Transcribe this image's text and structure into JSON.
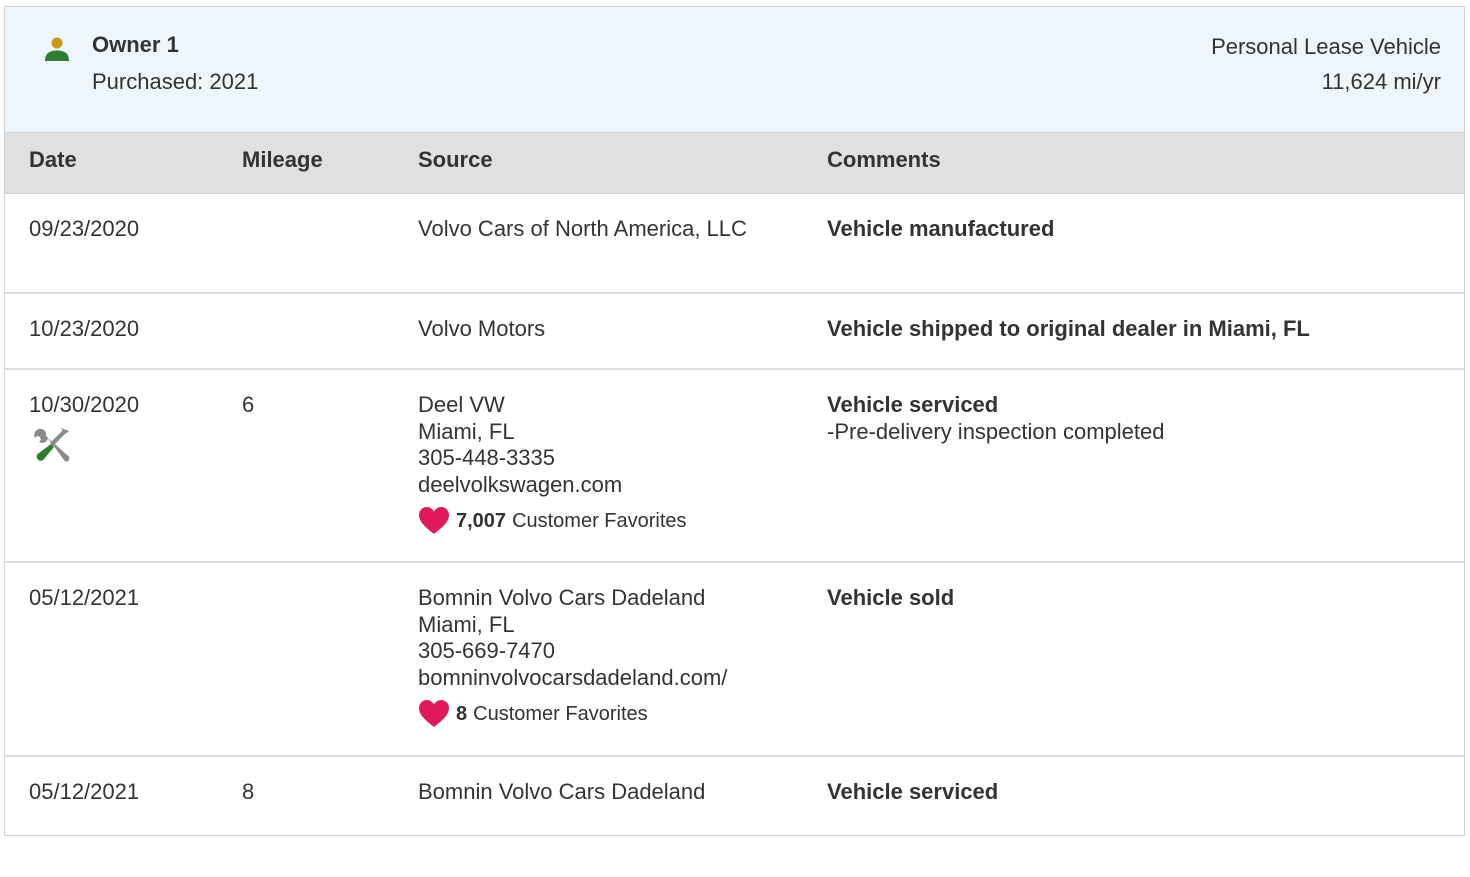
{
  "owner": {
    "title": "Owner 1",
    "purchased": "Purchased: 2021",
    "type": "Personal Lease Vehicle",
    "miles_per_year": "11,624 mi/yr"
  },
  "columns": {
    "date": "Date",
    "mileage": "Mileage",
    "source": "Source",
    "comments": "Comments"
  },
  "rows": [
    {
      "date": "09/23/2020",
      "mileage": "",
      "source": [
        "Volvo Cars of North America, LLC"
      ],
      "comment": "Vehicle manufactured"
    },
    {
      "date": "10/23/2020",
      "mileage": "",
      "source": [
        "Volvo Motors"
      ],
      "comment": "Vehicle shipped to original dealer in Miami, FL"
    },
    {
      "date": "10/30/2020",
      "mileage": "6",
      "service_icon": "wrench-screwdriver-icon",
      "source": [
        "Deel VW",
        "Miami, FL",
        "305-448-3335",
        "deelvolkswagen.com"
      ],
      "favorites_count": "7,007",
      "favorites_label": "Customer Favorites",
      "comment": "Vehicle serviced",
      "comment_detail": "-Pre-delivery inspection completed"
    },
    {
      "date": "05/12/2021",
      "mileage": "",
      "source": [
        "Bomnin Volvo Cars Dadeland",
        "Miami, FL",
        "305-669-7470",
        "bomninvolvocarsdadeland.com/"
      ],
      "favorites_count": "8",
      "favorites_label": "Customer Favorites",
      "comment": "Vehicle sold"
    },
    {
      "date": "05/12/2021",
      "mileage": "8",
      "source": [
        "Bomnin Volvo Cars Dadeland"
      ],
      "comment": "Vehicle serviced"
    }
  ],
  "colors": {
    "header_bg": "#eef5fb",
    "table_head_bg": "#e0e0e0",
    "heart": "#e0195e",
    "owner_icon_head": "#c9961a",
    "owner_icon_body": "#2e7d32"
  }
}
